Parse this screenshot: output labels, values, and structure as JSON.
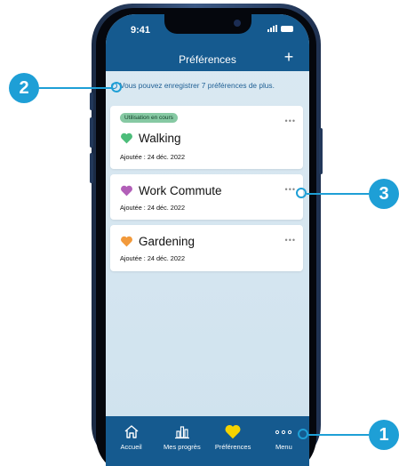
{
  "status_bar": {
    "time": "9:41"
  },
  "header": {
    "title": "Préférences",
    "add_icon": "plus-icon",
    "add_label": "+"
  },
  "info_text": "Vous pouvez enregistrer 7 préférences de plus.",
  "cards": [
    {
      "badge": "Utilisation en cours",
      "name": "Walking",
      "heart_color": "#4dbd7a",
      "date": "Ajoutée : 24 déc. 2022",
      "more": "•••"
    },
    {
      "badge": "",
      "name": "Work Commute",
      "heart_color": "#b25fb8",
      "date": "Ajoutée : 24 déc. 2022",
      "more": "•••"
    },
    {
      "badge": "",
      "name": "Gardening",
      "heart_color": "#f29a3c",
      "date": "Ajoutée : 24 déc. 2022",
      "more": "•••"
    }
  ],
  "tabbar": {
    "tabs": [
      {
        "label": "Accueil",
        "icon": "home-icon"
      },
      {
        "label": "Mes progrès",
        "icon": "bar-chart-icon"
      },
      {
        "label": "Préférences",
        "icon": "heart-icon",
        "active": true
      },
      {
        "label": "Menu",
        "icon": "more-dots-icon"
      }
    ]
  },
  "callouts": {
    "one": "1",
    "two": "2",
    "three": "3"
  },
  "colors": {
    "header": "#155a8f",
    "accent": "#1e9fd6",
    "active_heart": "#f5d300"
  }
}
